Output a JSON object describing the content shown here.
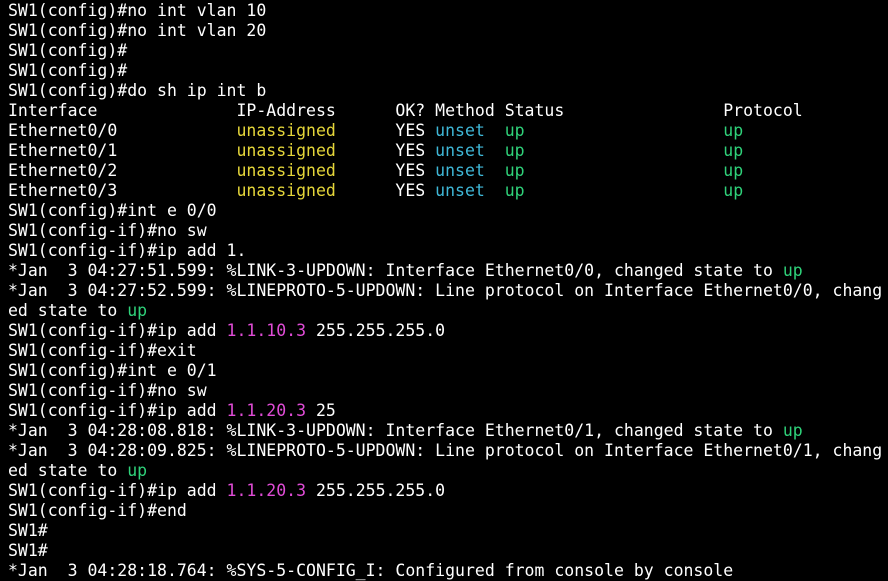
{
  "colors": {
    "background": "#000000",
    "default": "#ffffff",
    "yellow": "#e5d63a",
    "cyan": "#3fb8d8",
    "green": "#2fd27a",
    "magenta": "#e04cd6"
  },
  "lines": [
    [
      {
        "t": "SW1(config)#no int vlan 10",
        "c": "default"
      }
    ],
    [
      {
        "t": "SW1(config)#no int vlan 20",
        "c": "default"
      }
    ],
    [
      {
        "t": "SW1(config)#",
        "c": "default"
      }
    ],
    [
      {
        "t": "SW1(config)#",
        "c": "default"
      }
    ],
    [
      {
        "t": "SW1(config)#do sh ip int b",
        "c": "default"
      }
    ],
    [
      {
        "t": "Interface              IP-Address      OK? Method Status                Protocol",
        "c": "default"
      }
    ],
    [
      {
        "t": "Ethernet0/0            ",
        "c": "default"
      },
      {
        "t": "unassigned",
        "c": "yellow"
      },
      {
        "t": "      YES ",
        "c": "default"
      },
      {
        "t": "unset",
        "c": "cyan"
      },
      {
        "t": "  ",
        "c": "default"
      },
      {
        "t": "up",
        "c": "green"
      },
      {
        "t": "                    ",
        "c": "default"
      },
      {
        "t": "up",
        "c": "green"
      }
    ],
    [
      {
        "t": "Ethernet0/1            ",
        "c": "default"
      },
      {
        "t": "unassigned",
        "c": "yellow"
      },
      {
        "t": "      YES ",
        "c": "default"
      },
      {
        "t": "unset",
        "c": "cyan"
      },
      {
        "t": "  ",
        "c": "default"
      },
      {
        "t": "up",
        "c": "green"
      },
      {
        "t": "                    ",
        "c": "default"
      },
      {
        "t": "up",
        "c": "green"
      }
    ],
    [
      {
        "t": "Ethernet0/2            ",
        "c": "default"
      },
      {
        "t": "unassigned",
        "c": "yellow"
      },
      {
        "t": "      YES ",
        "c": "default"
      },
      {
        "t": "unset",
        "c": "cyan"
      },
      {
        "t": "  ",
        "c": "default"
      },
      {
        "t": "up",
        "c": "green"
      },
      {
        "t": "                    ",
        "c": "default"
      },
      {
        "t": "up",
        "c": "green"
      }
    ],
    [
      {
        "t": "Ethernet0/3            ",
        "c": "default"
      },
      {
        "t": "unassigned",
        "c": "yellow"
      },
      {
        "t": "      YES ",
        "c": "default"
      },
      {
        "t": "unset",
        "c": "cyan"
      },
      {
        "t": "  ",
        "c": "default"
      },
      {
        "t": "up",
        "c": "green"
      },
      {
        "t": "                    ",
        "c": "default"
      },
      {
        "t": "up",
        "c": "green"
      }
    ],
    [
      {
        "t": "SW1(config)#int e 0/0",
        "c": "default"
      }
    ],
    [
      {
        "t": "SW1(config-if)#no sw",
        "c": "default"
      }
    ],
    [
      {
        "t": "SW1(config-if)#ip add 1.",
        "c": "default"
      }
    ],
    [
      {
        "t": "*Jan  3 04:27:51.599: %LINK-3-UPDOWN: Interface Ethernet0/0, changed state to ",
        "c": "default"
      },
      {
        "t": "up",
        "c": "green"
      }
    ],
    [
      {
        "t": "*Jan  3 04:27:52.599: %LINEPROTO-5-UPDOWN: Line protocol on Interface Ethernet0/0, chang",
        "c": "default"
      }
    ],
    [
      {
        "t": "ed state to ",
        "c": "default"
      },
      {
        "t": "up",
        "c": "green"
      }
    ],
    [
      {
        "t": "SW1(config-if)#ip add ",
        "c": "default"
      },
      {
        "t": "1.1.10.3",
        "c": "magenta"
      },
      {
        "t": " 255.255.255.0",
        "c": "default"
      }
    ],
    [
      {
        "t": "SW1(config-if)#exit",
        "c": "default"
      }
    ],
    [
      {
        "t": "SW1(config)#int e 0/1",
        "c": "default"
      }
    ],
    [
      {
        "t": "SW1(config-if)#no sw",
        "c": "default"
      }
    ],
    [
      {
        "t": "SW1(config-if)#ip add ",
        "c": "default"
      },
      {
        "t": "1.1.20.3",
        "c": "magenta"
      },
      {
        "t": " 25",
        "c": "default"
      }
    ],
    [
      {
        "t": "*Jan  3 04:28:08.818: %LINK-3-UPDOWN: Interface Ethernet0/1, changed state to ",
        "c": "default"
      },
      {
        "t": "up",
        "c": "green"
      }
    ],
    [
      {
        "t": "*Jan  3 04:28:09.825: %LINEPROTO-5-UPDOWN: Line protocol on Interface Ethernet0/1, chang",
        "c": "default"
      }
    ],
    [
      {
        "t": "ed state to ",
        "c": "default"
      },
      {
        "t": "up",
        "c": "green"
      }
    ],
    [
      {
        "t": "SW1(config-if)#ip add ",
        "c": "default"
      },
      {
        "t": "1.1.20.3",
        "c": "magenta"
      },
      {
        "t": " 255.255.255.0",
        "c": "default"
      }
    ],
    [
      {
        "t": "SW1(config-if)#end",
        "c": "default"
      }
    ],
    [
      {
        "t": "SW1#",
        "c": "default"
      }
    ],
    [
      {
        "t": "SW1#",
        "c": "default"
      }
    ],
    [
      {
        "t": "*Jan  3 04:28:18.764: %SYS-5-CONFIG_I: Configured from console by console",
        "c": "default"
      }
    ]
  ]
}
